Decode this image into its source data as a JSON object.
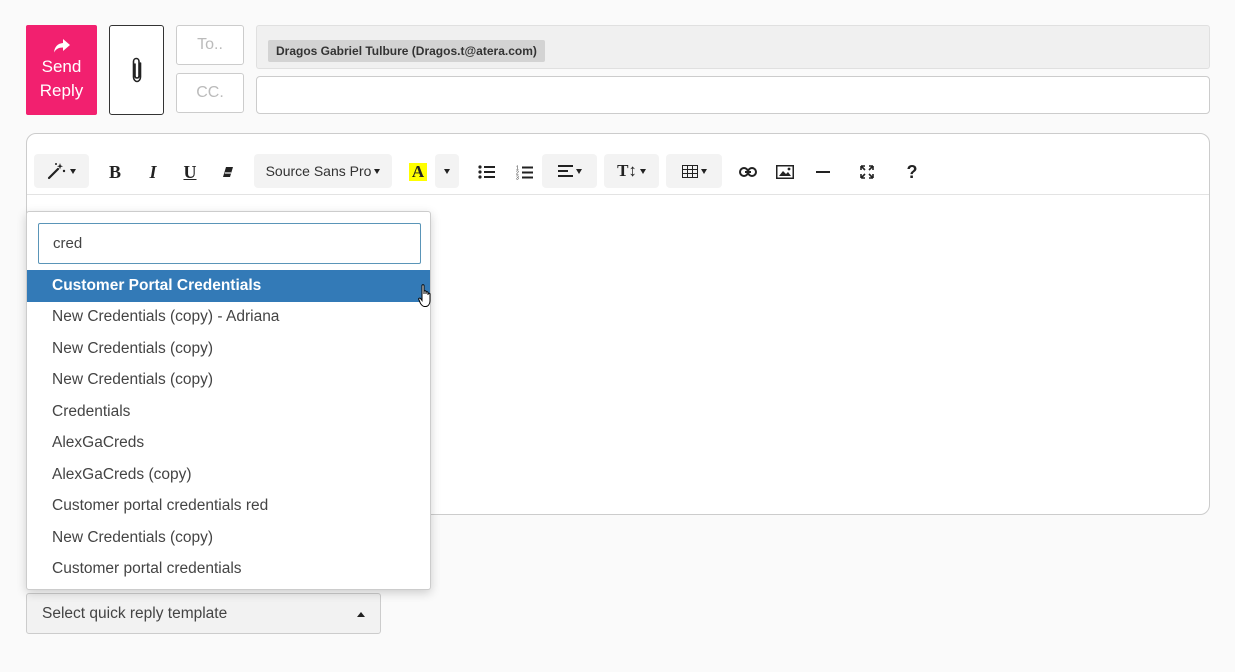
{
  "compose": {
    "send_line1": "Send",
    "send_line2": "Reply",
    "to_label": "To..",
    "cc_label": "CC.",
    "recipient": "Dragos Gabriel Tulbure (Dragos.t@atera.com)",
    "send_color": "#f2206f",
    "attach_icon": "paperclip-icon"
  },
  "toolbar": {
    "font_family": "Source Sans Pro",
    "text_color_letter": "A",
    "icons": [
      "magic-icon",
      "bold-icon",
      "italic-icon",
      "underline-icon",
      "eraser-icon",
      "text-color-icon",
      "unordered-list-icon",
      "ordered-list-icon",
      "align-icon",
      "font-size-icon",
      "table-icon",
      "link-icon",
      "image-icon",
      "horizontal-rule-icon",
      "fullscreen-icon",
      "help-icon"
    ]
  },
  "dropdown": {
    "search_value": "cred",
    "selected_color": "#337ab7",
    "items": [
      "Customer Portal Credentials",
      "New Credentials (copy) - Adriana",
      "New Credentials (copy)",
      "New Credentials (copy)",
      "Credentials",
      "AlexGaCreds",
      "AlexGaCreds (copy)",
      "Customer portal credentials red",
      "New Credentials (copy)",
      "Customer portal credentials"
    ]
  },
  "template_select": {
    "label": "Select quick reply template"
  }
}
